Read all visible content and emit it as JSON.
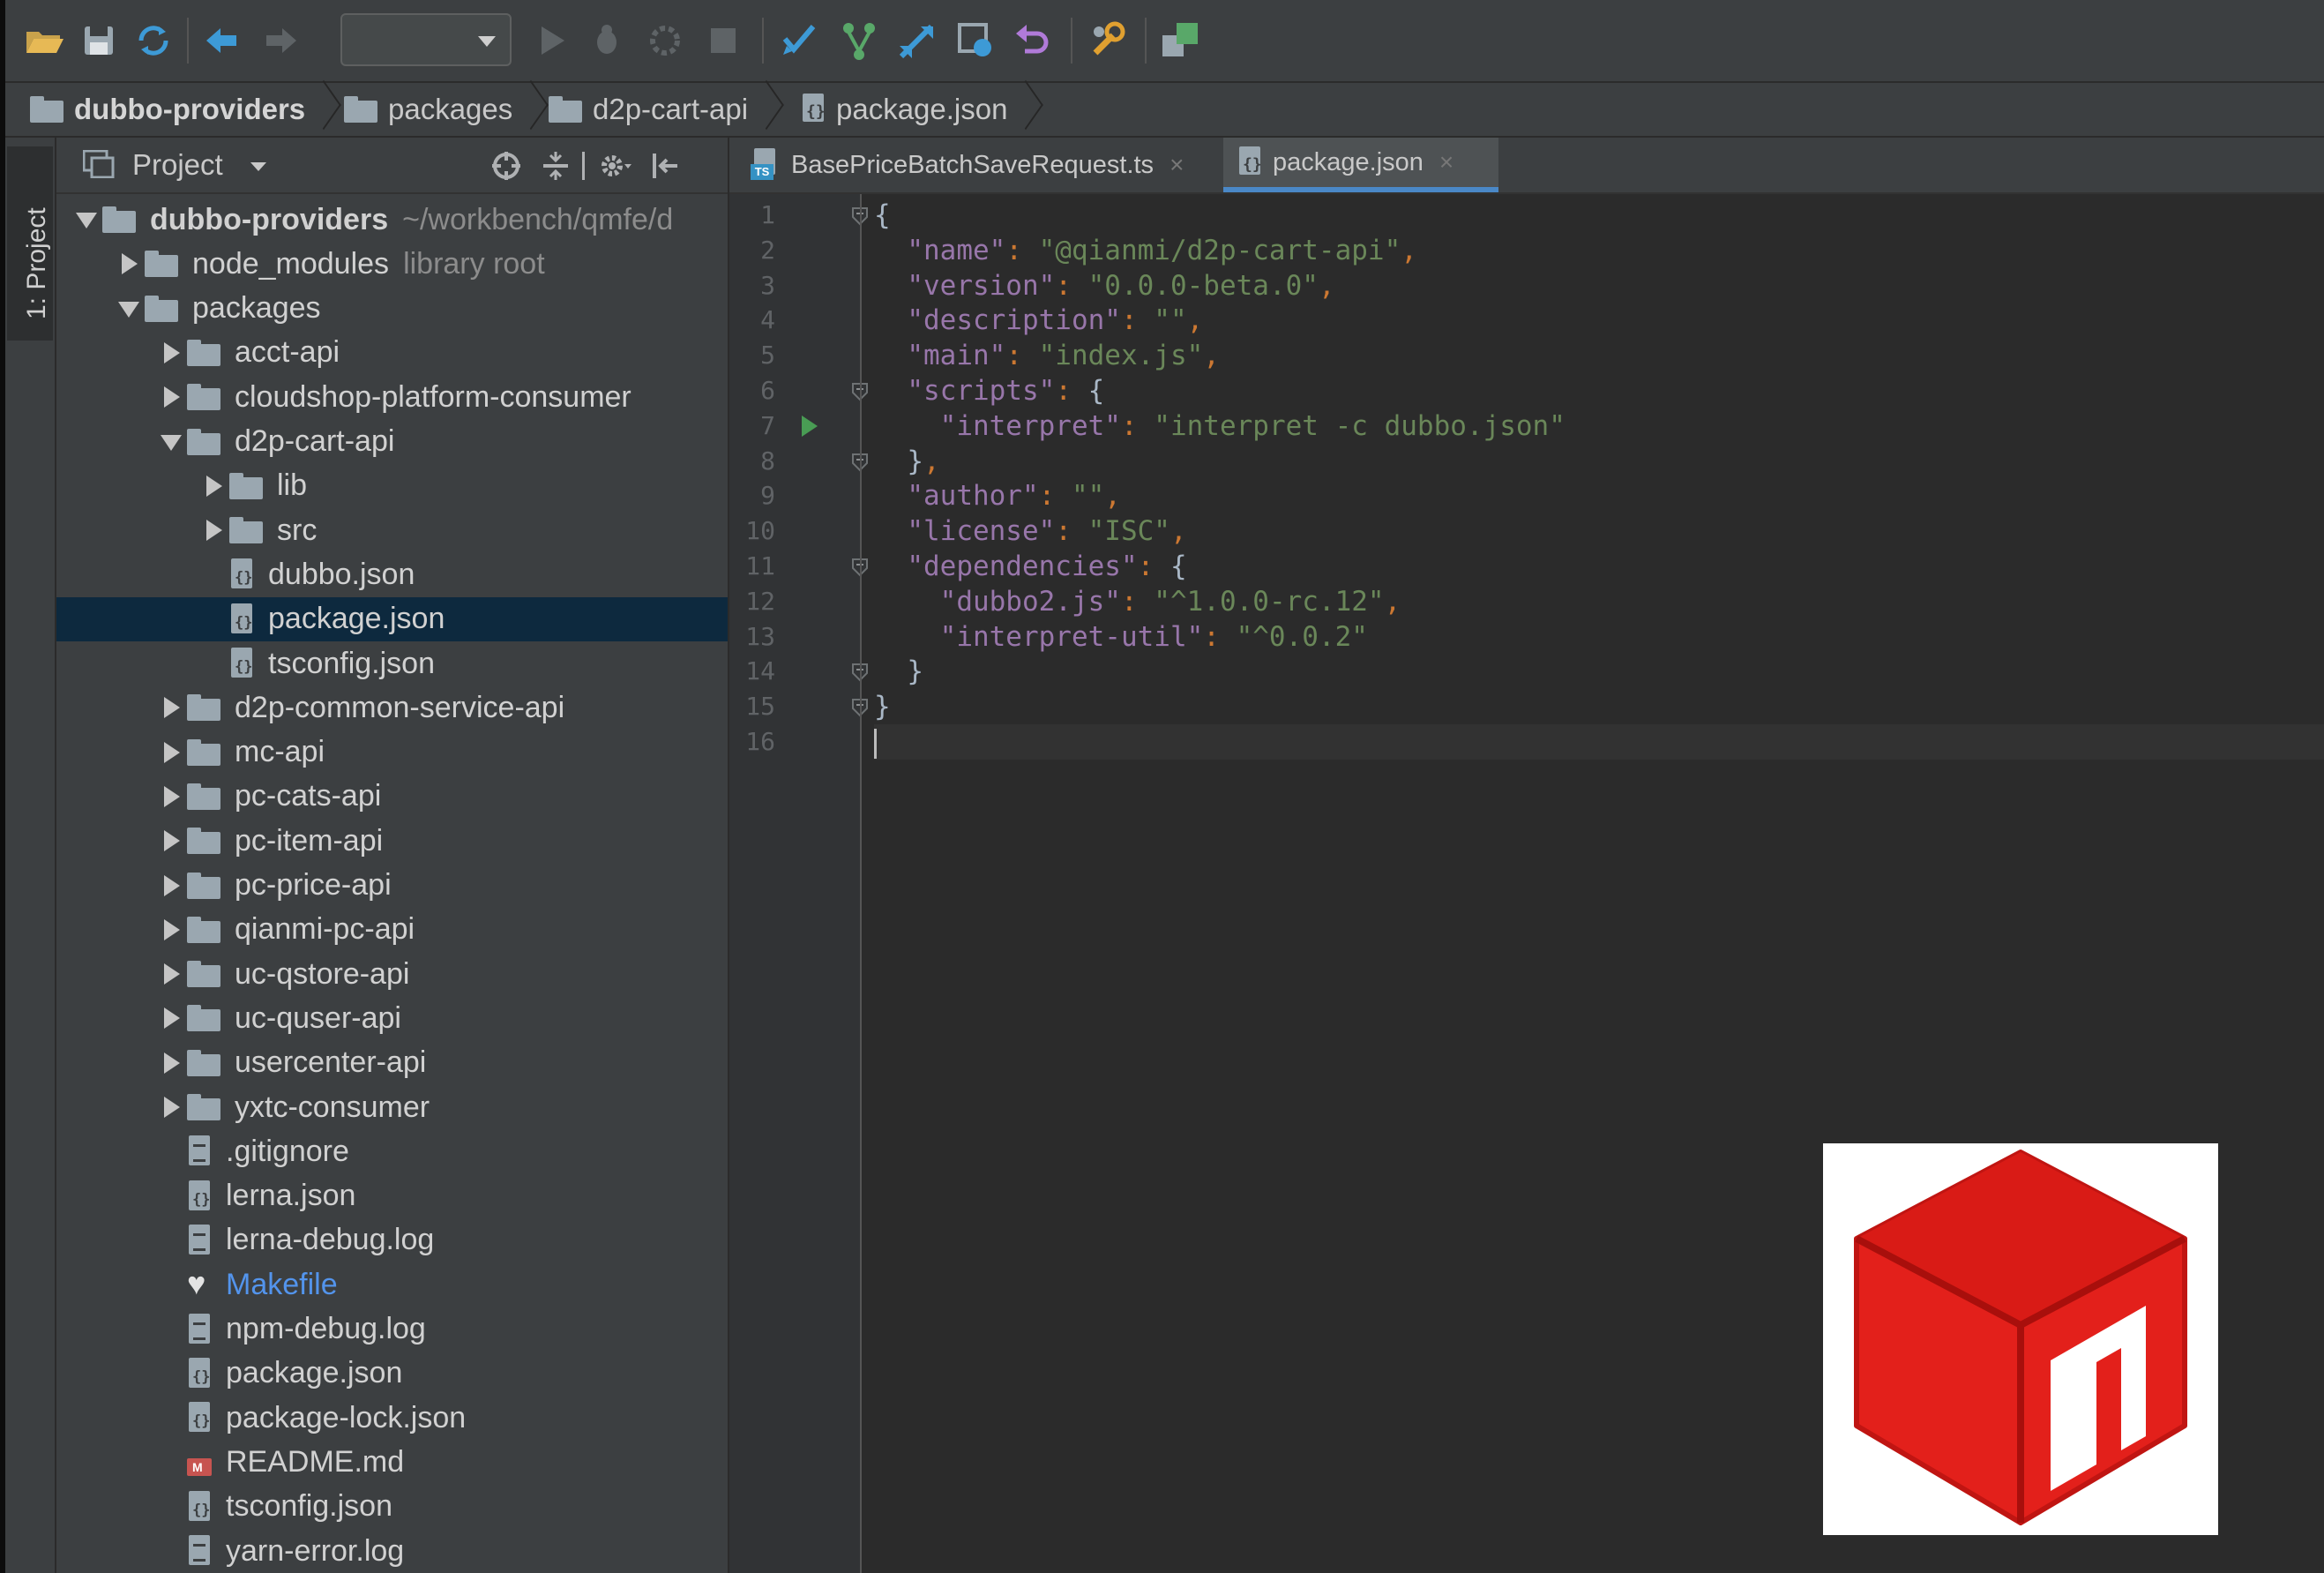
{
  "breadcrumb": [
    {
      "label": "dubbo-providers",
      "icon": "folder-icon"
    },
    {
      "label": "packages",
      "icon": "folder-icon"
    },
    {
      "label": "d2p-cart-api",
      "icon": "folder-icon"
    },
    {
      "label": "package.json",
      "icon": "json-file-icon"
    }
  ],
  "sidebar": {
    "stripe_label": "1: Project"
  },
  "project_panel": {
    "title": "Project",
    "tree": [
      {
        "label": "dubbo-providers",
        "hint": "~/workbench/qmfe/d",
        "depth": 0,
        "arrow": "down",
        "icon": "folder",
        "bold": true
      },
      {
        "label": "node_modules",
        "hint": "library root",
        "depth": 1,
        "arrow": "right",
        "icon": "folder"
      },
      {
        "label": "packages",
        "depth": 1,
        "arrow": "down",
        "icon": "folder"
      },
      {
        "label": "acct-api",
        "depth": 2,
        "arrow": "right",
        "icon": "folder"
      },
      {
        "label": "cloudshop-platform-consumer",
        "depth": 2,
        "arrow": "right",
        "icon": "folder"
      },
      {
        "label": "d2p-cart-api",
        "depth": 2,
        "arrow": "down",
        "icon": "folder"
      },
      {
        "label": "lib",
        "depth": 3,
        "arrow": "right",
        "icon": "folder"
      },
      {
        "label": "src",
        "depth": 3,
        "arrow": "right",
        "icon": "folder"
      },
      {
        "label": "dubbo.json",
        "depth": 3,
        "arrow": "none",
        "icon": "json"
      },
      {
        "label": "package.json",
        "depth": 3,
        "arrow": "none",
        "icon": "json",
        "selected": true
      },
      {
        "label": "tsconfig.json",
        "depth": 3,
        "arrow": "none",
        "icon": "json"
      },
      {
        "label": "d2p-common-service-api",
        "depth": 2,
        "arrow": "right",
        "icon": "folder"
      },
      {
        "label": "mc-api",
        "depth": 2,
        "arrow": "right",
        "icon": "folder"
      },
      {
        "label": "pc-cats-api",
        "depth": 2,
        "arrow": "right",
        "icon": "folder"
      },
      {
        "label": "pc-item-api",
        "depth": 2,
        "arrow": "right",
        "icon": "folder"
      },
      {
        "label": "pc-price-api",
        "depth": 2,
        "arrow": "right",
        "icon": "folder"
      },
      {
        "label": "qianmi-pc-api",
        "depth": 2,
        "arrow": "right",
        "icon": "folder"
      },
      {
        "label": "uc-qstore-api",
        "depth": 2,
        "arrow": "right",
        "icon": "folder"
      },
      {
        "label": "uc-quser-api",
        "depth": 2,
        "arrow": "right",
        "icon": "folder"
      },
      {
        "label": "usercenter-api",
        "depth": 2,
        "arrow": "right",
        "icon": "folder"
      },
      {
        "label": "yxtc-consumer",
        "depth": 2,
        "arrow": "right",
        "icon": "folder"
      },
      {
        "label": ".gitignore",
        "depth": 2,
        "arrow": "none",
        "icon": "text"
      },
      {
        "label": "lerna.json",
        "depth": 2,
        "arrow": "none",
        "icon": "json"
      },
      {
        "label": "lerna-debug.log",
        "depth": 2,
        "arrow": "none",
        "icon": "text"
      },
      {
        "label": "Makefile",
        "depth": 2,
        "arrow": "none",
        "icon": "make",
        "blue": true
      },
      {
        "label": "npm-debug.log",
        "depth": 2,
        "arrow": "none",
        "icon": "text"
      },
      {
        "label": "package.json",
        "depth": 2,
        "arrow": "none",
        "icon": "json"
      },
      {
        "label": "package-lock.json",
        "depth": 2,
        "arrow": "none",
        "icon": "json"
      },
      {
        "label": "README.md",
        "depth": 2,
        "arrow": "none",
        "icon": "md"
      },
      {
        "label": "tsconfig.json",
        "depth": 2,
        "arrow": "none",
        "icon": "json"
      },
      {
        "label": "yarn-error.log",
        "depth": 2,
        "arrow": "none",
        "icon": "text"
      }
    ]
  },
  "editor": {
    "tabs": [
      {
        "label": "BasePriceBatchSaveRequest.ts",
        "close": "×",
        "active": false
      },
      {
        "label": "package.json",
        "close": "×",
        "active": true
      }
    ],
    "lines": [
      {
        "n": "1",
        "tokens": [
          [
            "b",
            "{"
          ]
        ]
      },
      {
        "n": "2",
        "tokens": [
          [
            "b",
            "  "
          ],
          [
            "k",
            "\"name\""
          ],
          [
            "p",
            ": "
          ],
          [
            "s",
            "\"@qianmi/d2p-cart-api\""
          ],
          [
            "p",
            ","
          ]
        ]
      },
      {
        "n": "3",
        "tokens": [
          [
            "b",
            "  "
          ],
          [
            "k",
            "\"version\""
          ],
          [
            "p",
            ": "
          ],
          [
            "s",
            "\"0.0.0-beta.0\""
          ],
          [
            "p",
            ","
          ]
        ]
      },
      {
        "n": "4",
        "tokens": [
          [
            "b",
            "  "
          ],
          [
            "k",
            "\"description\""
          ],
          [
            "p",
            ": "
          ],
          [
            "s",
            "\"\""
          ],
          [
            "p",
            ","
          ]
        ]
      },
      {
        "n": "5",
        "tokens": [
          [
            "b",
            "  "
          ],
          [
            "k",
            "\"main\""
          ],
          [
            "p",
            ": "
          ],
          [
            "s",
            "\"index.js\""
          ],
          [
            "p",
            ","
          ]
        ]
      },
      {
        "n": "6",
        "tokens": [
          [
            "b",
            "  "
          ],
          [
            "k",
            "\"scripts\""
          ],
          [
            "p",
            ": "
          ],
          [
            "b",
            "{"
          ]
        ]
      },
      {
        "n": "7",
        "tokens": [
          [
            "b",
            "    "
          ],
          [
            "k",
            "\"interpret\""
          ],
          [
            "p",
            ": "
          ],
          [
            "s",
            "\"interpret -c dubbo.json\""
          ]
        ]
      },
      {
        "n": "8",
        "tokens": [
          [
            "b",
            "  }"
          ],
          [
            "p",
            ","
          ]
        ]
      },
      {
        "n": "9",
        "tokens": [
          [
            "b",
            "  "
          ],
          [
            "k",
            "\"author\""
          ],
          [
            "p",
            ": "
          ],
          [
            "s",
            "\"\""
          ],
          [
            "p",
            ","
          ]
        ]
      },
      {
        "n": "10",
        "tokens": [
          [
            "b",
            "  "
          ],
          [
            "k",
            "\"license\""
          ],
          [
            "p",
            ": "
          ],
          [
            "s",
            "\"ISC\""
          ],
          [
            "p",
            ","
          ]
        ]
      },
      {
        "n": "11",
        "tokens": [
          [
            "b",
            "  "
          ],
          [
            "k",
            "\"dependencies\""
          ],
          [
            "p",
            ": "
          ],
          [
            "b",
            "{"
          ]
        ]
      },
      {
        "n": "12",
        "tokens": [
          [
            "b",
            "    "
          ],
          [
            "k",
            "\"dubbo2.js\""
          ],
          [
            "p",
            ": "
          ],
          [
            "s",
            "\"^1.0.0-rc.12\""
          ],
          [
            "p",
            ","
          ]
        ]
      },
      {
        "n": "13",
        "tokens": [
          [
            "b",
            "    "
          ],
          [
            "k",
            "\"interpret-util\""
          ],
          [
            "p",
            ": "
          ],
          [
            "s",
            "\"^0.0.2\""
          ]
        ]
      },
      {
        "n": "14",
        "tokens": [
          [
            "b",
            "  }"
          ]
        ]
      },
      {
        "n": "15",
        "tokens": [
          [
            "b",
            "}"
          ]
        ]
      },
      {
        "n": "16",
        "tokens": [],
        "current": true
      }
    ],
    "fold_lines": [
      1,
      6,
      8,
      11,
      14,
      15
    ],
    "run_line": 7
  },
  "colors": {
    "selection": "#0d293e",
    "active_tab_underline": "#4a88c7",
    "json_key": "#9876aa",
    "json_string": "#6a8759",
    "logo_red": "#e3201b"
  }
}
